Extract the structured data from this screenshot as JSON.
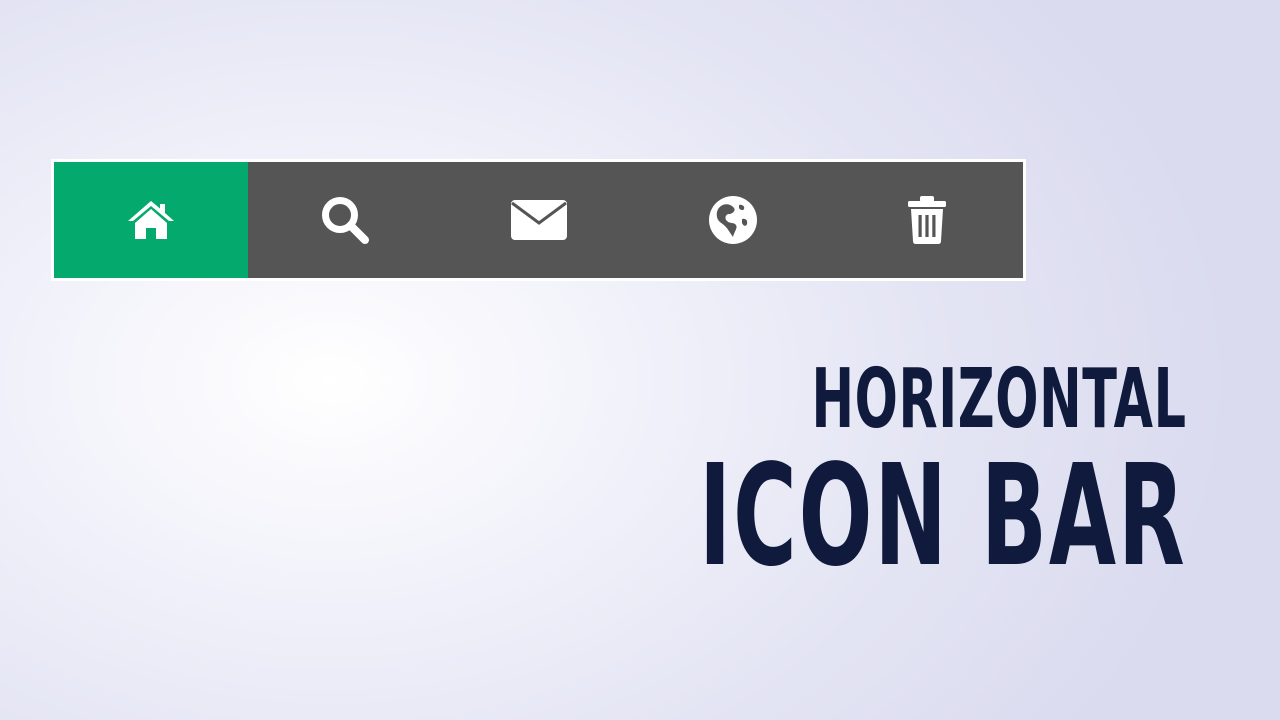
{
  "nav": {
    "items": [
      {
        "icon": "home-icon",
        "active": true
      },
      {
        "icon": "search-icon",
        "active": false
      },
      {
        "icon": "envelope-icon",
        "active": false
      },
      {
        "icon": "globe-icon",
        "active": false
      },
      {
        "icon": "trash-icon",
        "active": false
      }
    ]
  },
  "colors": {
    "accent": "#04aa6d",
    "bar_background": "#555555",
    "icon_color": "#ffffff",
    "title_color": "#0f1a3d"
  },
  "title": {
    "line1": "HORIZONTAL",
    "line2": "ICON BAR"
  }
}
